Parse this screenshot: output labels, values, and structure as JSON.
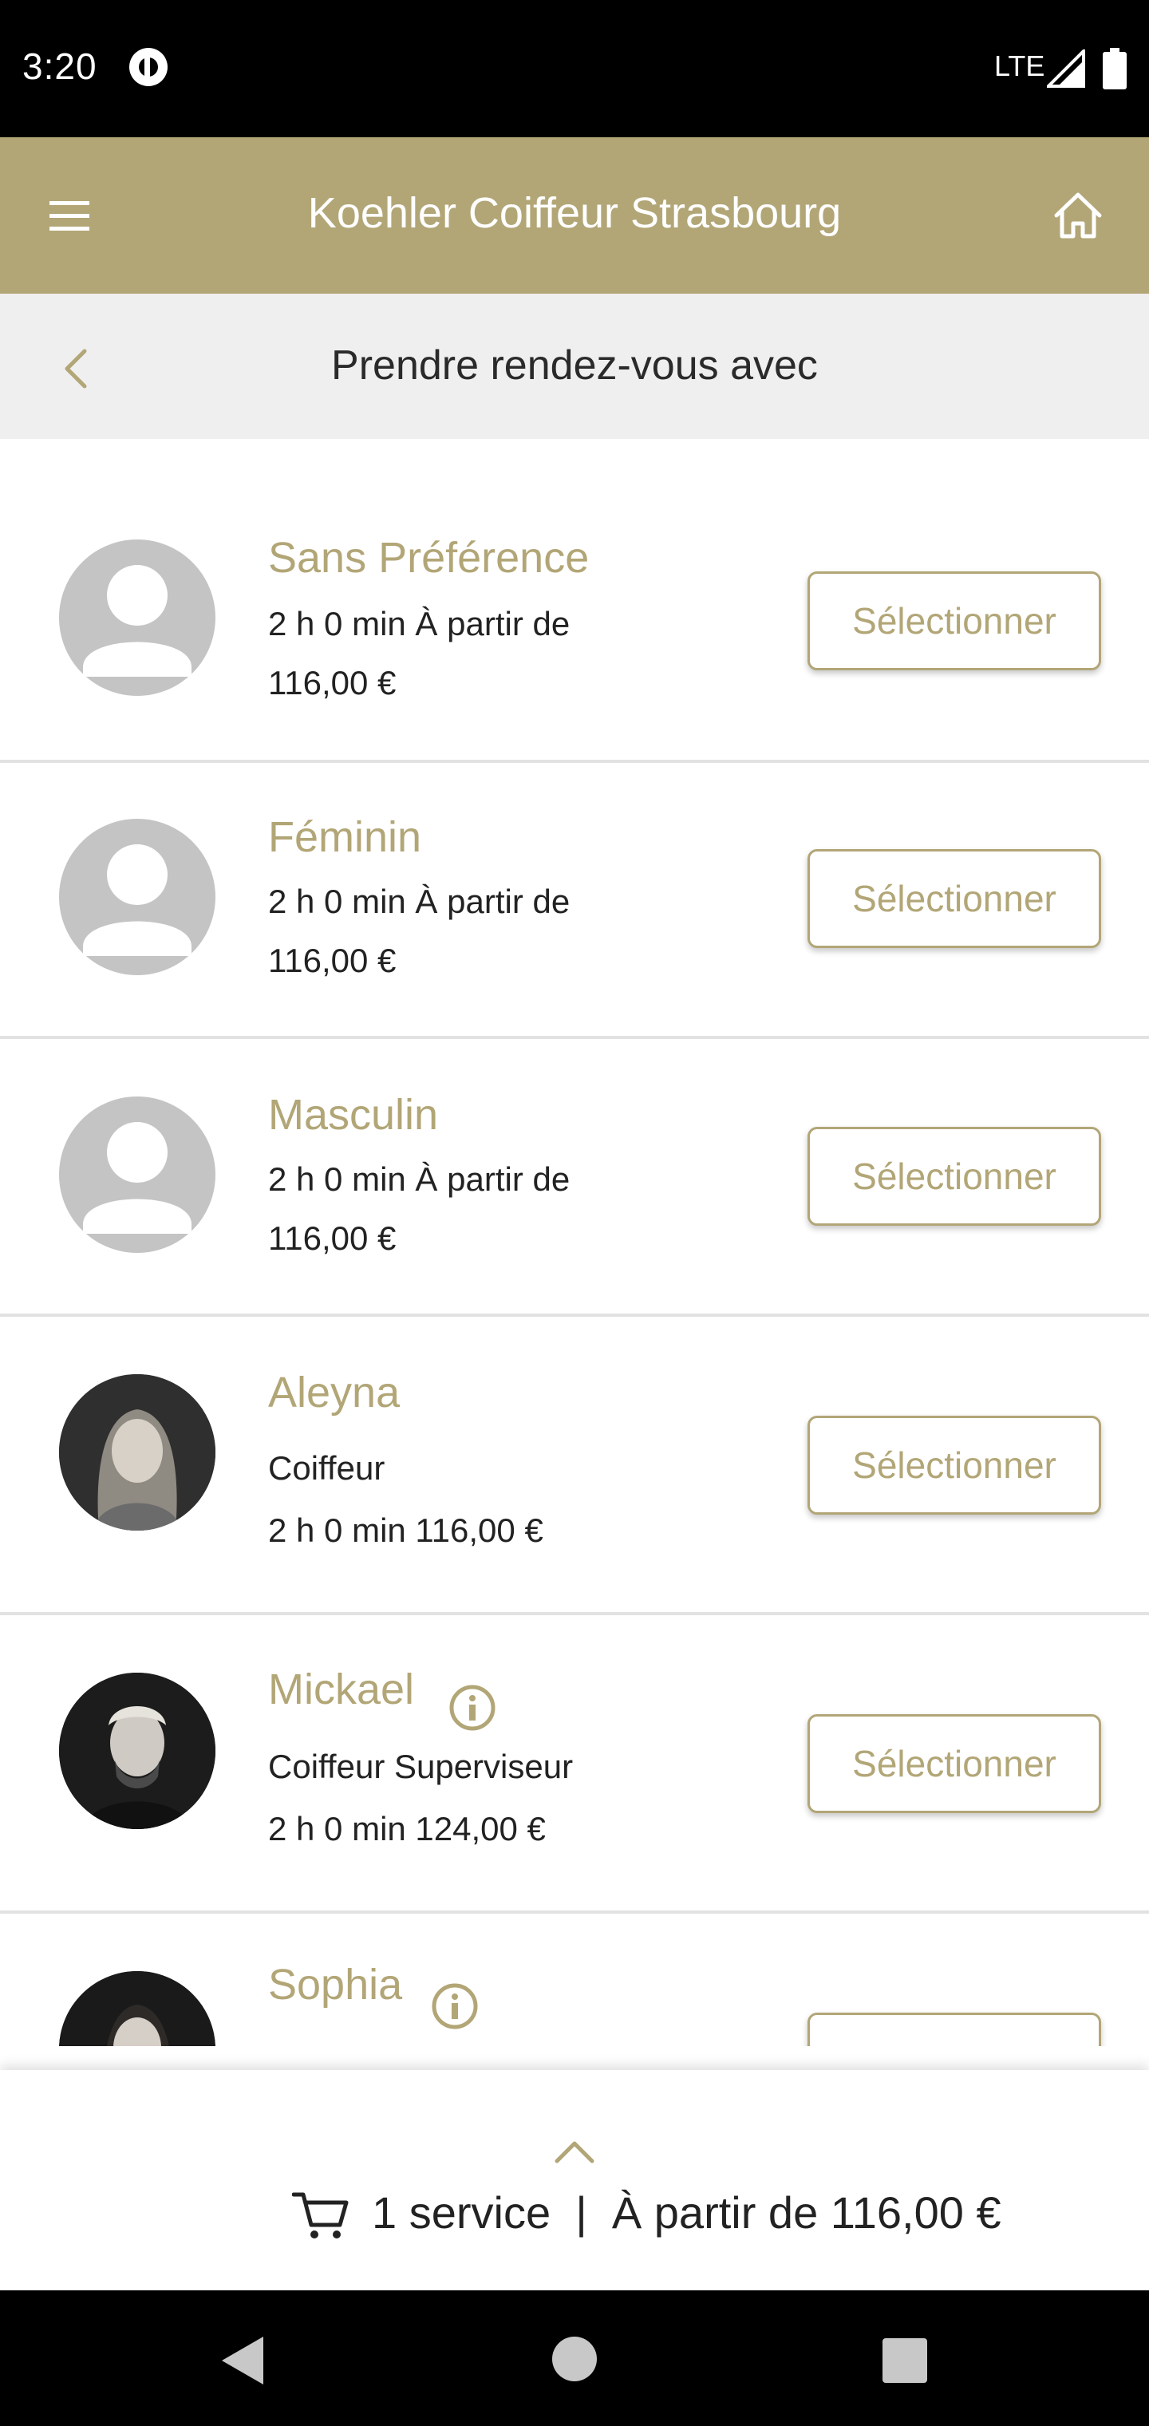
{
  "status_bar": {
    "time": "3:20",
    "network": "LTE"
  },
  "app_bar": {
    "title": "Koehler Coiffeur Strasbourg"
  },
  "sub_header": {
    "title": "Prendre rendez-vous avec"
  },
  "select_label": "Sélectionner",
  "stylists": [
    {
      "name": "Sans Préférence",
      "line1": "2 h 0 min À partir de",
      "line2": "116,00 €",
      "avatar": "placeholder"
    },
    {
      "name": "Féminin",
      "line1": "2 h 0 min À partir de",
      "line2": "116,00 €",
      "avatar": "placeholder"
    },
    {
      "name": "Masculin",
      "line1": "2 h 0 min À partir de",
      "line2": "116,00 €",
      "avatar": "placeholder"
    },
    {
      "name": "Aleyna",
      "line1": "Coiffeur",
      "line2": "2 h 0 min 116,00 €",
      "avatar": "photo"
    },
    {
      "name": "Mickael",
      "line1": "Coiffeur Superviseur",
      "line2": "2 h 0 min 124,00 €",
      "avatar": "photo",
      "info": true
    },
    {
      "name": "Sophia",
      "avatar": "photo",
      "info": true
    }
  ],
  "cart": {
    "summary": "1 service  |  À partir de 116,00 €"
  },
  "colors": {
    "accent": "#b2a677",
    "subheader_bg": "#efefef",
    "placeholder_avatar": "#c4c4c4"
  }
}
